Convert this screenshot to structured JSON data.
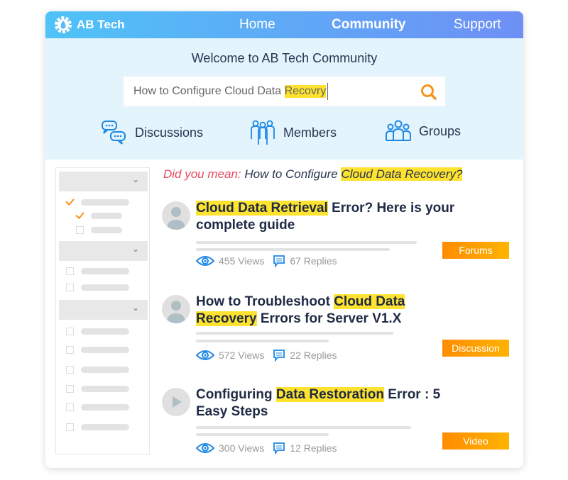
{
  "header": {
    "brand": "AB Tech",
    "nav": [
      "Home",
      "Community",
      "Support"
    ],
    "active": "Community"
  },
  "hero": {
    "welcome": "Welcome to AB Tech Community",
    "search": {
      "value_plain": "How to Configure Cloud Data ",
      "value_highlight": "Recovry"
    },
    "categories": [
      {
        "label": "Discussions",
        "icon": "chat-bubbles-icon"
      },
      {
        "label": "Members",
        "icon": "members-icon"
      },
      {
        "label": "Groups",
        "icon": "groups-icon"
      }
    ]
  },
  "suggestion": {
    "prefix": "Did you mean:",
    "plain": "How to Configure",
    "highlight": "Cloud Data Recovery?"
  },
  "results": [
    {
      "title": [
        {
          "t": "Cloud Data Retrieval",
          "hl": true
        },
        {
          "t": " Error? Here is your complete guide",
          "hl": false
        }
      ],
      "views": "455 Views",
      "replies": "67 Replies",
      "badge": "Forums",
      "avatar": "user-icon"
    },
    {
      "title": [
        {
          "t": "How to Troubleshoot ",
          "hl": false
        },
        {
          "t": "Cloud Data Recovery",
          "hl": true
        },
        {
          "t": " Errors for Server V1.X",
          "hl": false
        }
      ],
      "views": "572 Views",
      "replies": "22 Replies",
      "badge": "Discussion",
      "avatar": "user-icon"
    },
    {
      "title": [
        {
          "t": "Configuring ",
          "hl": false
        },
        {
          "t": "Data Restoration",
          "hl": true
        },
        {
          "t": " Error : 5 Easy Steps",
          "hl": false
        }
      ],
      "views": "300 Views",
      "replies": "12 Replies",
      "badge": "Video",
      "avatar": "play-icon"
    }
  ],
  "colors": {
    "accent": "#f7931e",
    "highlight": "#fde22f",
    "header_start": "#4fc3f7",
    "header_end": "#6e8ff5",
    "hero_bg": "#e3f4fd"
  }
}
